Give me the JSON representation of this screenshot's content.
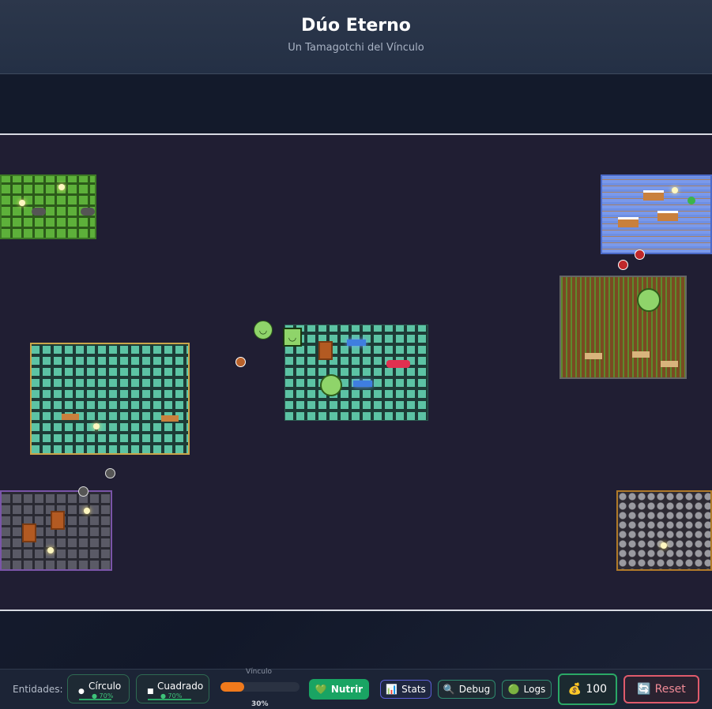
{
  "header": {
    "title": "Dúo Eterno",
    "subtitle": "Un Tamagotchi del Vínculo"
  },
  "footer": {
    "entities_label": "Entidades:",
    "entities": [
      {
        "name": "Círculo",
        "percent": "● 70%",
        "icon": "●"
      },
      {
        "name": "Cuadrado",
        "percent": "● 70%",
        "icon": "■"
      }
    ],
    "bond": {
      "label": "Vínculo",
      "value": 0.3,
      "value_text": "30%"
    },
    "buttons": {
      "nutrir": "Nutrir",
      "stats": "Stats",
      "debug": "Debug",
      "logs": "Logs",
      "reset": "Reset"
    },
    "icons": {
      "nutrir": "💚",
      "stats": "📊",
      "debug": "🔍",
      "logs": "🟢",
      "coins": "💰",
      "reset": "🔄"
    },
    "coins": "100"
  },
  "colors": {
    "accent": "#19a463",
    "bond": "#f07a1c",
    "reset": "#e05b6c",
    "coins_border": "#2aa866"
  }
}
